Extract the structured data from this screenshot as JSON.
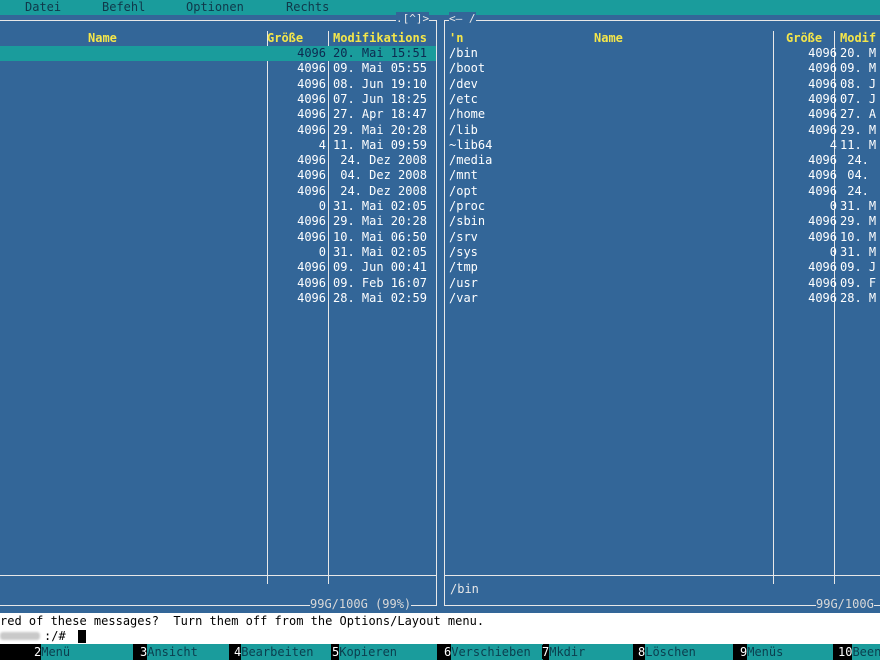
{
  "menubar": {
    "items": [
      "Datei",
      "Befehl",
      "Optionen",
      "Rechts"
    ]
  },
  "left_panel": {
    "top_label": ".[^]>",
    "columns": {
      "name": "Name",
      "size": "Größe",
      "mod": "Modifikations"
    },
    "rows": [
      {
        "name": "",
        "size": "4096",
        "mod": "20. Mai 15:51",
        "selected": true
      },
      {
        "name": "",
        "size": "4096",
        "mod": "09. Mai 05:55"
      },
      {
        "name": "",
        "size": "4096",
        "mod": "08. Jun 19:10"
      },
      {
        "name": "",
        "size": "4096",
        "mod": "07. Jun 18:25"
      },
      {
        "name": "",
        "size": "4096",
        "mod": "27. Apr 18:47"
      },
      {
        "name": "",
        "size": "4096",
        "mod": "29. Mai 20:28"
      },
      {
        "name": "",
        "size": "4",
        "mod": "11. Mai 09:59"
      },
      {
        "name": "",
        "size": "4096",
        "mod": " 24. Dez 2008"
      },
      {
        "name": "",
        "size": "4096",
        "mod": " 04. Dez 2008"
      },
      {
        "name": "",
        "size": "4096",
        "mod": " 24. Dez 2008"
      },
      {
        "name": "",
        "size": "0",
        "mod": "31. Mai 02:05"
      },
      {
        "name": "",
        "size": "4096",
        "mod": "29. Mai 20:28"
      },
      {
        "name": "",
        "size": "4096",
        "mod": "10. Mai 06:50"
      },
      {
        "name": "",
        "size": "0",
        "mod": "31. Mai 02:05"
      },
      {
        "name": "",
        "size": "4096",
        "mod": "09. Jun 00:41"
      },
      {
        "name": "",
        "size": "4096",
        "mod": "09. Feb 16:07"
      },
      {
        "name": "",
        "size": "4096",
        "mod": "28. Mai 02:59"
      }
    ],
    "footer": "99G/100G (99%)"
  },
  "right_panel": {
    "top_label": "<— /",
    "columns": {
      "dir": "'n",
      "name": "Name",
      "size": "Größe",
      "mod": "Modif"
    },
    "rows": [
      {
        "name": "/bin",
        "size": "4096",
        "mod": "20. M"
      },
      {
        "name": "/boot",
        "size": "4096",
        "mod": "09. M"
      },
      {
        "name": "/dev",
        "size": "4096",
        "mod": "08. J"
      },
      {
        "name": "/etc",
        "size": "4096",
        "mod": "07. J"
      },
      {
        "name": "/home",
        "size": "4096",
        "mod": "27. A"
      },
      {
        "name": "/lib",
        "size": "4096",
        "mod": "29. M"
      },
      {
        "name": "~lib64",
        "size": "4",
        "mod": "11. M"
      },
      {
        "name": "/media",
        "size": "4096",
        "mod": " 24. "
      },
      {
        "name": "/mnt",
        "size": "4096",
        "mod": " 04. "
      },
      {
        "name": "/opt",
        "size": "4096",
        "mod": " 24. "
      },
      {
        "name": "/proc",
        "size": "0",
        "mod": "31. M"
      },
      {
        "name": "/sbin",
        "size": "4096",
        "mod": "29. M"
      },
      {
        "name": "/srv",
        "size": "4096",
        "mod": "10. M"
      },
      {
        "name": "/sys",
        "size": "0",
        "mod": "31. M"
      },
      {
        "name": "/tmp",
        "size": "4096",
        "mod": "09. J"
      },
      {
        "name": "/usr",
        "size": "4096",
        "mod": "09. F"
      },
      {
        "name": "/var",
        "size": "4096",
        "mod": "28. M"
      }
    ],
    "mini_status": "/bin",
    "footer": "99G/100G"
  },
  "hint": {
    "text": "red of these messages?  Turn them off from the Options/Layout menu."
  },
  "command_line": {
    "prompt": ":/# "
  },
  "keybar": [
    {
      "num": "2",
      "label": "Menü"
    },
    {
      "num": "3",
      "label": "Ansicht"
    },
    {
      "num": "4",
      "label": "Bearbeiten"
    },
    {
      "num": "5",
      "label": "Kopieren"
    },
    {
      "num": "6",
      "label": "Verschieben"
    },
    {
      "num": "7",
      "label": "Mkdir"
    },
    {
      "num": "8",
      "label": "Löschen"
    },
    {
      "num": "9",
      "label": "Menüs"
    },
    {
      "num": "10",
      "label": "Beend"
    }
  ]
}
